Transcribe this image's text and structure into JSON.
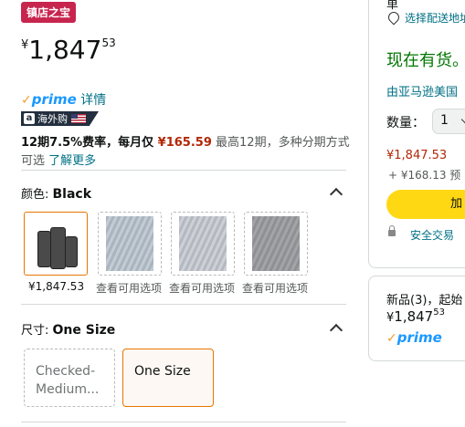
{
  "badge": "镇店之宝",
  "price": {
    "currency": "¥",
    "whole": "1,847",
    "fraction": "53"
  },
  "prime": {
    "check": "✓",
    "word": "prime",
    "details_link": "详情"
  },
  "overseas": {
    "label": "海外购"
  },
  "installment": {
    "part1": "12期7.5%费率，每月仅 ",
    "monthly": "¥165.59",
    "part2": " 最高12期，多种分期方式可选 ",
    "link": "了解更多"
  },
  "color_section": {
    "label": "颜色: ",
    "value": "Black",
    "swatches": [
      {
        "price": "¥1,847.53"
      },
      {
        "alt": "查看可用选项"
      },
      {
        "alt": "查看可用选项"
      },
      {
        "alt": "查看可用选项"
      }
    ]
  },
  "size_section": {
    "label": "尺寸: ",
    "value": "One Size",
    "options": [
      {
        "label": "Checked-Medium..."
      },
      {
        "label": "One Size"
      }
    ]
  },
  "buybox": {
    "top_text": "单",
    "delivery_link": "选择配送地址",
    "in_stock": "现在有货。",
    "seller": "由亚马逊美国",
    "qty_label": "数量：",
    "qty_value": "1",
    "price": "¥1,847.53",
    "plus_fee": "+ ¥168.13 预",
    "add_to_cart": "加",
    "secure": "安全交易"
  },
  "offers": {
    "new_label": "新品(3)，起始",
    "price_currency": "¥",
    "price_whole": "1,847",
    "price_fraction": "53",
    "prime_check": "✓",
    "prime_word": "prime"
  },
  "colors": {
    "price_red": "#B12704",
    "link": "#007185",
    "badge": "#C7254E",
    "cart_yellow": "#FFD814",
    "prime_blue": "#1A98FF",
    "instock_green": "#007600"
  }
}
